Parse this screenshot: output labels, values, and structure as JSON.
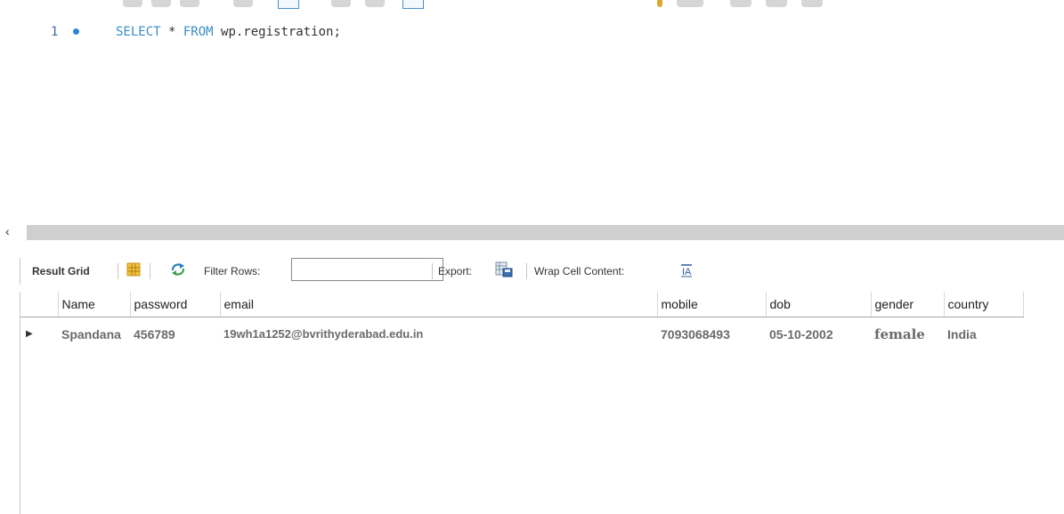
{
  "editor": {
    "line_number": "1",
    "sql_keyword_select": "SELECT",
    "sql_star": " * ",
    "sql_keyword_from": "FROM",
    "sql_rest": " wp.registration;"
  },
  "results_toolbar": {
    "result_grid_label": "Result Grid",
    "filter_rows_label": "Filter Rows:",
    "filter_rows_value": "",
    "export_label": "Export:",
    "wrap_label": "Wrap Cell Content:"
  },
  "grid": {
    "columns": [
      "Name",
      "password",
      "email",
      "mobile",
      "dob",
      "gender",
      "country"
    ],
    "rows": [
      [
        "Spandana",
        "456789",
        "19wh1a1252@bvrithyderabad.edu.in",
        "7093068493",
        "05-10-2002",
        "female",
        "India"
      ]
    ]
  },
  "colors": {
    "keyword": "#3a8dc3",
    "scrollbar": "#cfcfcf"
  }
}
